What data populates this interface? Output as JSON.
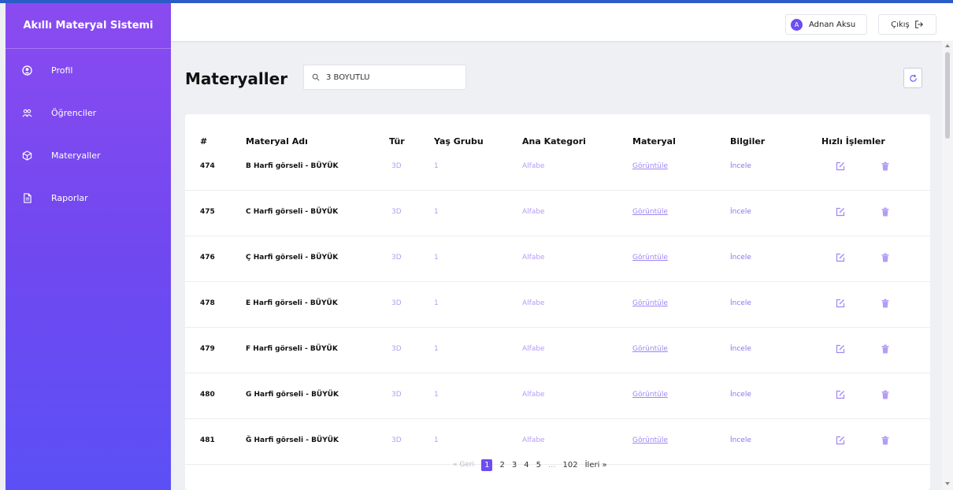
{
  "app_title": "Akıllı Materyal Sistemi",
  "sidebar": {
    "items": [
      {
        "label": "Profil",
        "icon": "user-circle-icon"
      },
      {
        "label": "Öğrenciler",
        "icon": "users-icon"
      },
      {
        "label": "Materyaller",
        "icon": "cube-icon"
      },
      {
        "label": "Raporlar",
        "icon": "document-icon"
      }
    ]
  },
  "topbar": {
    "user_initial": "A",
    "user_name": "Adnan Aksu",
    "logout_label": "Çıkış"
  },
  "page": {
    "title": "Materyaller",
    "search_value": "3 BOYUTLU"
  },
  "table": {
    "headers": [
      "#",
      "Materyal Adı",
      "Tür",
      "Yaş Grubu",
      "Ana Kategori",
      "Materyal",
      "Bilgiler",
      "Hızlı İşlemler"
    ],
    "rows": [
      {
        "id": "474",
        "name": "B Harfi görseli - BÜYÜK",
        "type": "3D",
        "age": "1",
        "category": "Alfabe",
        "material": "Görüntüle",
        "info": "İncele"
      },
      {
        "id": "475",
        "name": "C Harfi görseli - BÜYÜK",
        "type": "3D",
        "age": "1",
        "category": "Alfabe",
        "material": "Görüntüle",
        "info": "İncele"
      },
      {
        "id": "476",
        "name": "Ç Harfi görseli - BÜYÜK",
        "type": "3D",
        "age": "1",
        "category": "Alfabe",
        "material": "Görüntüle",
        "info": "İncele"
      },
      {
        "id": "478",
        "name": "E Harfi görseli - BÜYÜK",
        "type": "3D",
        "age": "1",
        "category": "Alfabe",
        "material": "Görüntüle",
        "info": "İncele"
      },
      {
        "id": "479",
        "name": "F Harfi görseli - BÜYÜK",
        "type": "3D",
        "age": "1",
        "category": "Alfabe",
        "material": "Görüntüle",
        "info": "İncele"
      },
      {
        "id": "480",
        "name": "G Harfi görseli - BÜYÜK",
        "type": "3D",
        "age": "1",
        "category": "Alfabe",
        "material": "Görüntüle",
        "info": "İncele"
      },
      {
        "id": "481",
        "name": "Ğ Harfi görseli - BÜYÜK",
        "type": "3D",
        "age": "1",
        "category": "Alfabe",
        "material": "Görüntüle",
        "info": "İncele"
      }
    ]
  },
  "pagination": {
    "prev": "« Geri",
    "pages": [
      "1",
      "2",
      "3",
      "4",
      "5"
    ],
    "active": "1",
    "ellipsis": "...",
    "last": "102",
    "next": "İleri »"
  },
  "colors": {
    "accent": "#6d4df2",
    "sidebar_top": "#8a4bf0",
    "sidebar_bottom": "#5b50f5",
    "edit_icon": "#9f86f4",
    "delete_icon": "#b49cf7"
  }
}
